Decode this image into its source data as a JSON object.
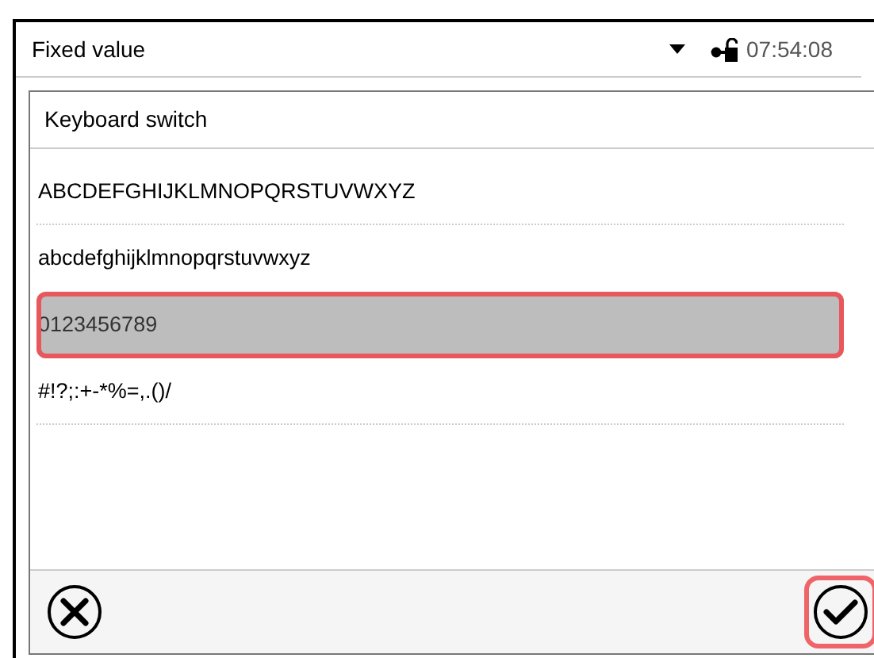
{
  "header": {
    "title": "Fixed value",
    "time": "07:54:08"
  },
  "dialog": {
    "title": "Keyboard switch",
    "options": [
      {
        "label": "ABCDEFGHIJKLMNOPQRSTUVWXYZ",
        "selected": false,
        "highlighted": false
      },
      {
        "label": "abcdefghijklmnopqrstuvwxyz",
        "selected": false,
        "highlighted": false
      },
      {
        "label": "0123456789",
        "selected": true,
        "highlighted": true
      },
      {
        "label": "#!?;:+-*%=,.()/",
        "selected": false,
        "highlighted": false
      }
    ],
    "buttons": [
      {
        "kind": "cancel",
        "highlighted": false
      },
      {
        "kind": "confirm",
        "highlighted": true
      }
    ]
  }
}
